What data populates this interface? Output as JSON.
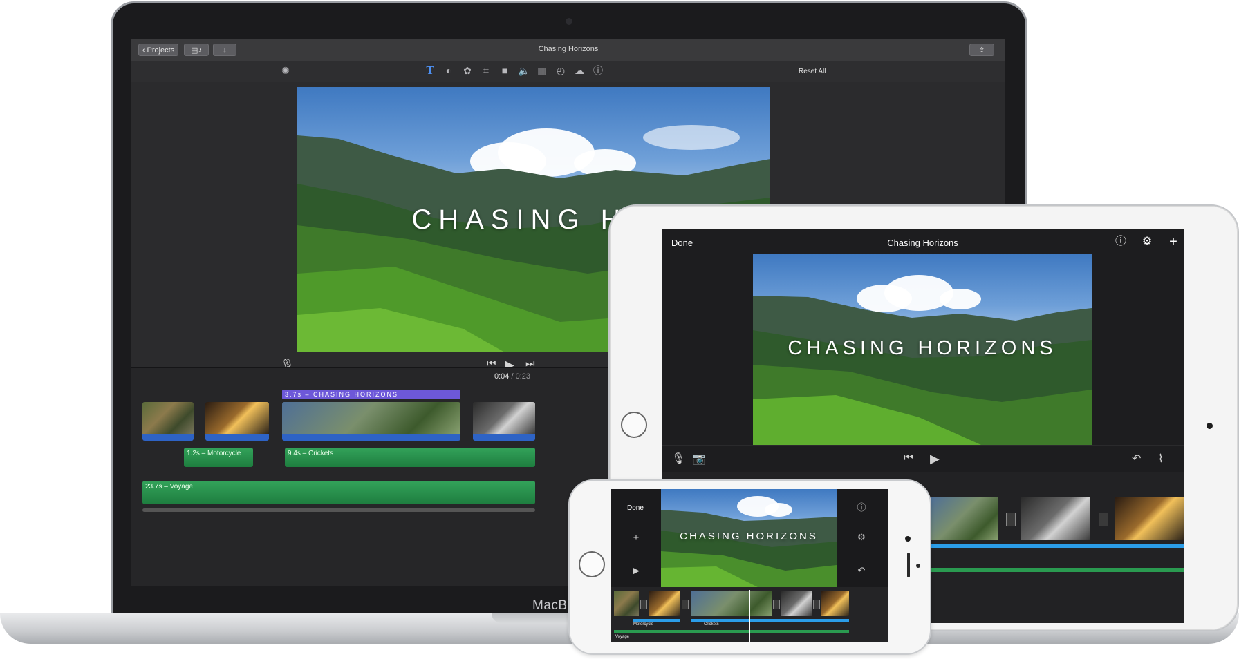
{
  "macbook": {
    "brand": "MacBo",
    "toolbar": {
      "projects_label": "Projects",
      "title": "Chasing Horizons",
      "reset_all": "Reset All"
    },
    "viewer": {
      "title_text": "CHASING HO",
      "timecode_current": "0:04",
      "timecode_sep": "/",
      "timecode_total": "0:23"
    },
    "timeline": {
      "title_clip": "3.7s – CHASING HORIZONS",
      "audio_clips": [
        {
          "label": "1.2s – Motorcycle"
        },
        {
          "label": "9.4s – Crickets"
        },
        {
          "label": "23.7s – Voyage"
        }
      ]
    }
  },
  "ipad": {
    "done": "Done",
    "title": "Chasing Horizons",
    "viewer_title": "CHASING HORIZONS"
  },
  "iphone": {
    "done": "Done",
    "viewer_title": "CHASING HORIZONS",
    "labels": {
      "motorcycle": "Motorcycle",
      "crickets": "Crickets",
      "voyage": "Voyage"
    }
  },
  "colors": {
    "title_purple": "#6d58d9",
    "clip_blue": "#2e63c5",
    "audio_green": "#2a9a50",
    "ios_blue": "#2b9de8"
  }
}
